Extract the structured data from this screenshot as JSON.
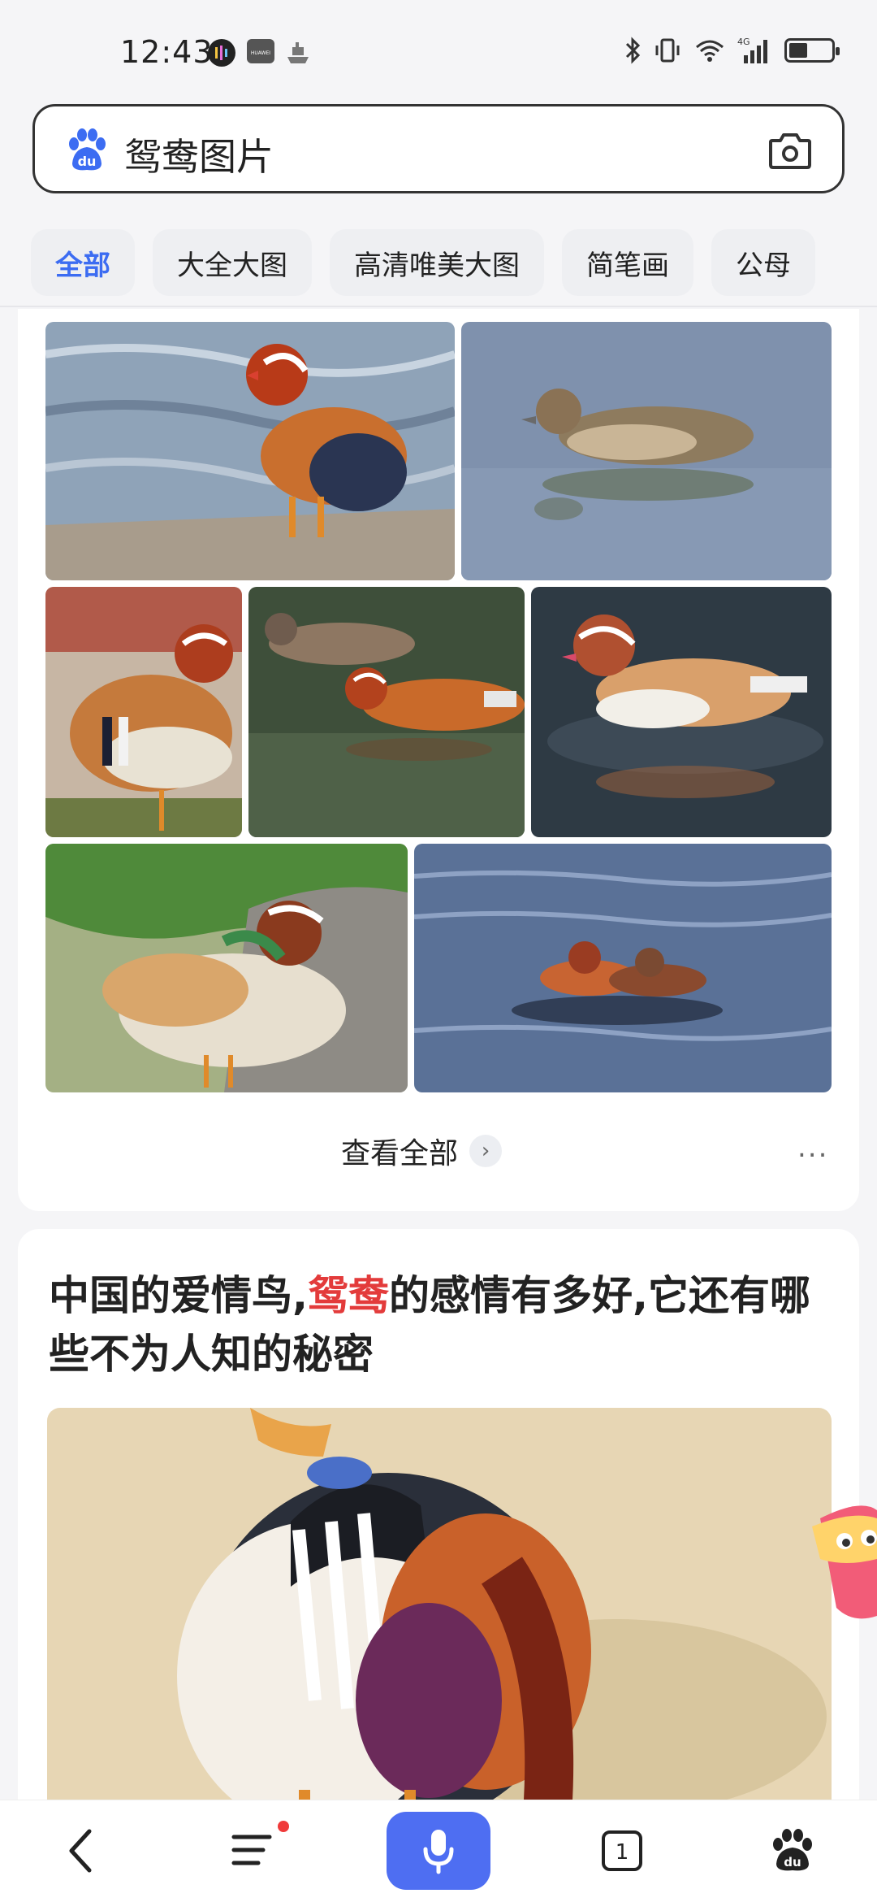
{
  "status_bar": {
    "time": "12:43",
    "app_icon_label": "HUAWEI",
    "network": "4G"
  },
  "search": {
    "query": "鸳鸯图片",
    "logo_text": "du",
    "logo_icon": "baidu-paw-icon",
    "camera_icon": "camera-icon"
  },
  "filters": {
    "chips": [
      "全部",
      "大全大图",
      "高清唯美大图",
      "简笔画",
      "公母"
    ],
    "active_index": 0,
    "accent_color": "#3c6cf2"
  },
  "image_results": {
    "view_all_label": "查看全部",
    "more_label": "..."
  },
  "article": {
    "title_before": "中国的爱情鸟,",
    "title_highlight": "鸳鸯",
    "title_after": "的感情有多好,它还有哪些不为人知的秘密",
    "highlight_color": "#e33b3b"
  },
  "bottom_nav": {
    "back_icon": "back-icon",
    "menu_icon": "menu-icon",
    "mic_icon": "microphone-icon",
    "tabs_count": "1",
    "home_icon": "baidu-paw-icon",
    "mic_color": "#4e6ef2"
  }
}
